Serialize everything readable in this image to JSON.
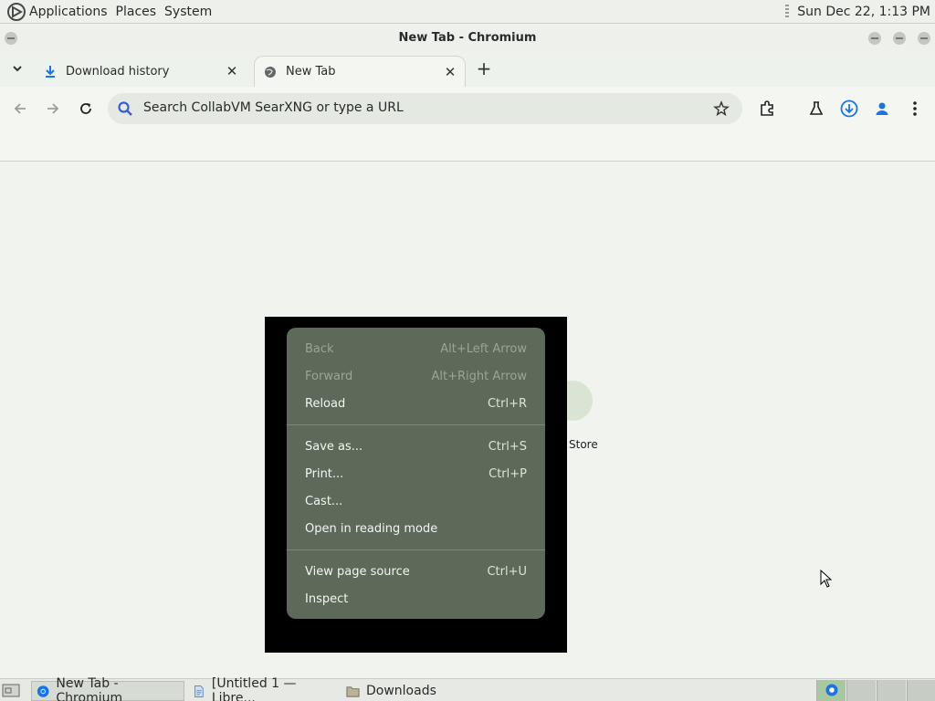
{
  "top_panel": {
    "menus": [
      "Applications",
      "Places",
      "System"
    ],
    "clock": "Sun Dec 22,  1:13 PM"
  },
  "window": {
    "title": "New Tab - Chromium"
  },
  "tabs": [
    {
      "label": "Download history",
      "icon": "download-icon",
      "active": false
    },
    {
      "label": "New Tab",
      "icon": "globe-icon",
      "active": true
    }
  ],
  "toolbar": {
    "omnibox_placeholder": "Search CollabVM SearXNG or type a URL"
  },
  "page": {
    "shortcut_label": "Store"
  },
  "context_menu": {
    "groups": [
      [
        {
          "label": "Back",
          "shortcut": "Alt+Left Arrow",
          "enabled": false
        },
        {
          "label": "Forward",
          "shortcut": "Alt+Right Arrow",
          "enabled": false
        },
        {
          "label": "Reload",
          "shortcut": "Ctrl+R",
          "enabled": true
        }
      ],
      [
        {
          "label": "Save as...",
          "shortcut": "Ctrl+S",
          "enabled": true
        },
        {
          "label": "Print...",
          "shortcut": "Ctrl+P",
          "enabled": true
        },
        {
          "label": "Cast...",
          "shortcut": "",
          "enabled": true
        },
        {
          "label": "Open in reading mode",
          "shortcut": "",
          "enabled": true
        }
      ],
      [
        {
          "label": "View page source",
          "shortcut": "Ctrl+U",
          "enabled": true
        },
        {
          "label": "Inspect",
          "shortcut": "",
          "enabled": true
        }
      ]
    ]
  },
  "taskbar": {
    "tasks": [
      {
        "label": "New Tab - Chromium",
        "icon": "chromium-icon"
      },
      {
        "label": "[Untitled 1 — Libre...",
        "icon": "document-icon"
      },
      {
        "label": "Downloads",
        "icon": "folder-icon"
      }
    ]
  },
  "colors": {
    "menu_bg": "#5d6a5a",
    "page_bg": "#f0f3ee",
    "accent": "#1a73e8"
  }
}
